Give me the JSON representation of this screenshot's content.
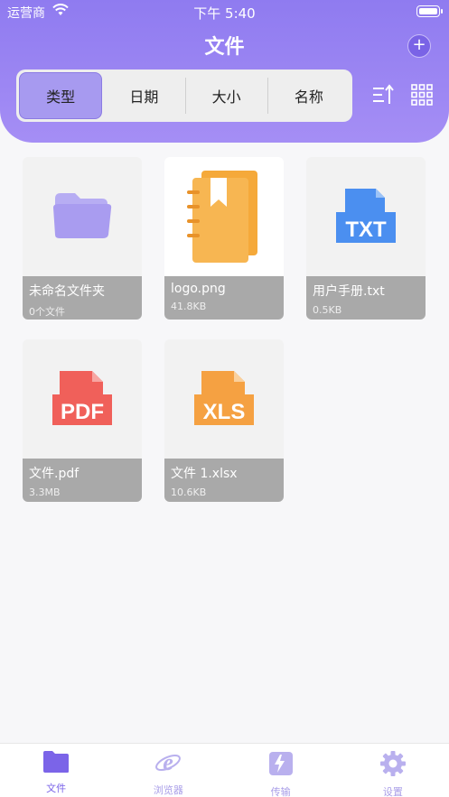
{
  "status": {
    "carrier": "运营商",
    "time": "下午 5:40"
  },
  "header": {
    "title": "文件",
    "add_label": "+"
  },
  "segments": [
    "类型",
    "日期",
    "大小",
    "名称"
  ],
  "files": [
    {
      "name": "未命名文件夹",
      "size": "0个文件",
      "kind": "folder-icon"
    },
    {
      "name": "logo.png",
      "size": "41.8KB",
      "kind": "notebook-image"
    },
    {
      "name": "用户手册.txt",
      "size": "0.5KB",
      "kind": "txt-icon"
    },
    {
      "name": "文件.pdf",
      "size": "3.3MB",
      "kind": "pdf-icon"
    },
    {
      "name": "文件 1.xlsx",
      "size": "10.6KB",
      "kind": "xls-icon"
    }
  ],
  "file_badges": {
    "txt": "TXT",
    "pdf": "PDF",
    "xls": "XLS"
  },
  "tabbar": [
    {
      "label": "文件",
      "icon": "folder-icon"
    },
    {
      "label": "浏览器",
      "icon": "browser-icon"
    },
    {
      "label": "传输",
      "icon": "transfer-icon"
    },
    {
      "label": "设置",
      "icon": "gear-icon"
    }
  ],
  "colors": {
    "accent": "#8f7bf0",
    "folder": "#a99cf0",
    "txt": "#4b8ff0",
    "pdf": "#f0605a",
    "xls": "#f5a142",
    "notebook": "#f7b048"
  }
}
